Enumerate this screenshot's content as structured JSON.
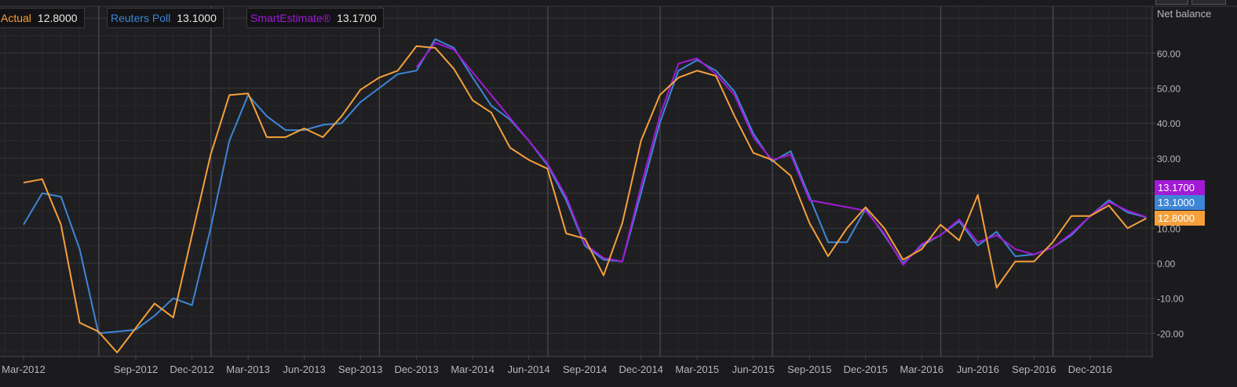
{
  "colors": {
    "background": "#1b1b1d",
    "plot_background": "#1f1f22",
    "grid": "#38383c",
    "axis_text": "#b8b8bc",
    "actual": "#f5a03a",
    "reuters": "#3d86d6",
    "smart": "#a21ad6"
  },
  "legend": {
    "actual": {
      "name": "Actual",
      "value": "12.8000"
    },
    "reuters": {
      "name": "Reuters Poll",
      "value": "13.1000"
    },
    "smart": {
      "name": "SmartEstimate®",
      "value": "13.1700"
    }
  },
  "badges": {
    "smart": "13.1700",
    "reuters": "13.1000",
    "actual": "12.8000"
  },
  "chart_data": {
    "type": "line",
    "ylabel": "Net balance",
    "ylim": [
      -25,
      73
    ],
    "y_ticks": [
      -20,
      -10,
      0,
      10,
      20,
      30,
      40,
      50,
      60
    ],
    "y_tick_labels": [
      "-20.00",
      "-10.00",
      "0.00",
      "10.00",
      "20.00",
      "30.00",
      "40.00",
      "50.00",
      "60.00"
    ],
    "x_labels": [
      {
        "t": 0,
        "label": "Mar-2012"
      },
      {
        "t": 6,
        "label": "Sep-2012"
      },
      {
        "t": 9,
        "label": "Dec-2012"
      },
      {
        "t": 12,
        "label": "Mar-2013"
      },
      {
        "t": 15,
        "label": "Jun-2013"
      },
      {
        "t": 18,
        "label": "Sep-2013"
      },
      {
        "t": 21,
        "label": "Dec-2013"
      },
      {
        "t": 24,
        "label": "Mar-2014"
      },
      {
        "t": 27,
        "label": "Jun-2014"
      },
      {
        "t": 30,
        "label": "Sep-2014"
      },
      {
        "t": 33,
        "label": "Dec-2014"
      },
      {
        "t": 36,
        "label": "Mar-2015"
      },
      {
        "t": 39,
        "label": "Jun-2015"
      },
      {
        "t": 42,
        "label": "Sep-2015"
      },
      {
        "t": 45,
        "label": "Dec-2015"
      },
      {
        "t": 48,
        "label": "Mar-2016"
      },
      {
        "t": 51,
        "label": "Jun-2016"
      },
      {
        "t": 54,
        "label": "Sep-2016"
      },
      {
        "t": 57,
        "label": "Dec-2016"
      }
    ],
    "x_range": [
      0,
      60
    ],
    "major_grid_t": [
      4,
      10,
      19,
      28,
      34,
      40,
      49,
      55
    ],
    "series": [
      {
        "name": "Reuters Poll",
        "key": "reuters",
        "points": [
          [
            0,
            11
          ],
          [
            1,
            20
          ],
          [
            2,
            19
          ],
          [
            3,
            4
          ],
          [
            4,
            -20
          ],
          [
            5,
            -19.5
          ],
          [
            6,
            -19
          ],
          [
            7,
            -15
          ],
          [
            8,
            -10
          ],
          [
            9,
            -12
          ],
          [
            10,
            10
          ],
          [
            11,
            35
          ],
          [
            12,
            48
          ],
          [
            13,
            42
          ],
          [
            14,
            38
          ],
          [
            15,
            38
          ],
          [
            16,
            39.5
          ],
          [
            17,
            40
          ],
          [
            18,
            46
          ],
          [
            19,
            50
          ],
          [
            20,
            54
          ],
          [
            21,
            55
          ],
          [
            22,
            64
          ],
          [
            23,
            61.5
          ],
          [
            24,
            53
          ],
          [
            25,
            45
          ],
          [
            26,
            41
          ],
          [
            27,
            35
          ],
          [
            28,
            28
          ],
          [
            29,
            18
          ],
          [
            30,
            5
          ],
          [
            31,
            1
          ],
          [
            32,
            0.5
          ],
          [
            33,
            20
          ],
          [
            34,
            40
          ],
          [
            35,
            55
          ],
          [
            36,
            58
          ],
          [
            37,
            55
          ],
          [
            38,
            49
          ],
          [
            39,
            37
          ],
          [
            40,
            29
          ],
          [
            41,
            32
          ],
          [
            42,
            19
          ],
          [
            43,
            6
          ],
          [
            44,
            6
          ],
          [
            45,
            15.5
          ],
          [
            46,
            8
          ],
          [
            47,
            0
          ],
          [
            48,
            5
          ],
          [
            49,
            8
          ],
          [
            50,
            12
          ],
          [
            51,
            5
          ],
          [
            52,
            9
          ],
          [
            53,
            2
          ],
          [
            54,
            2.5
          ],
          [
            55,
            4.5
          ],
          [
            56,
            8
          ],
          [
            57,
            13.5
          ],
          [
            58,
            18
          ],
          [
            59,
            14.5
          ],
          [
            60,
            13.1
          ]
        ]
      },
      {
        "name": "SmartEstimate®",
        "key": "smart",
        "points": [
          [
            21,
            56
          ],
          [
            22,
            63
          ],
          [
            23,
            61
          ],
          [
            28,
            28.5
          ],
          [
            29,
            19
          ],
          [
            30,
            5.5
          ],
          [
            31,
            1.5
          ],
          [
            32,
            0.5
          ],
          [
            33,
            22
          ],
          [
            34,
            42
          ],
          [
            35,
            57
          ],
          [
            36,
            58.5
          ],
          [
            37,
            54
          ],
          [
            38,
            48
          ],
          [
            39,
            36
          ],
          [
            40,
            29.5
          ],
          [
            41,
            31
          ],
          [
            42,
            18
          ],
          [
            45,
            15
          ],
          [
            46,
            8.5
          ],
          [
            47,
            -0.5
          ],
          [
            48,
            5.5
          ],
          [
            49,
            8
          ],
          [
            50,
            12.5
          ],
          [
            51,
            6
          ],
          [
            52,
            8
          ],
          [
            53,
            4
          ],
          [
            54,
            2.5
          ],
          [
            55,
            4.5
          ],
          [
            56,
            8.5
          ],
          [
            57,
            13.5
          ],
          [
            58,
            17.5
          ],
          [
            59,
            15
          ],
          [
            60,
            13.17
          ]
        ]
      },
      {
        "name": "Actual",
        "key": "actual",
        "points": [
          [
            0,
            23
          ],
          [
            1,
            24
          ],
          [
            2,
            11
          ],
          [
            3,
            -17
          ],
          [
            4,
            -19.5
          ],
          [
            5,
            -25.5
          ],
          [
            6,
            -18.5
          ],
          [
            7,
            -11.5
          ],
          [
            8,
            -15.5
          ],
          [
            9,
            8
          ],
          [
            10,
            31
          ],
          [
            11,
            48
          ],
          [
            12,
            48.5
          ],
          [
            13,
            36
          ],
          [
            14,
            36
          ],
          [
            15,
            38.5
          ],
          [
            16,
            36
          ],
          [
            17,
            42
          ],
          [
            18,
            49.5
          ],
          [
            19,
            53
          ],
          [
            20,
            55
          ],
          [
            21,
            62
          ],
          [
            22,
            61.5
          ],
          [
            23,
            55.5
          ],
          [
            24,
            46.5
          ],
          [
            25,
            43
          ],
          [
            26,
            33
          ],
          [
            27,
            29.5
          ],
          [
            28,
            27
          ],
          [
            29,
            8.5
          ],
          [
            30,
            7
          ],
          [
            31,
            -3.5
          ],
          [
            32,
            11.5
          ],
          [
            33,
            35
          ],
          [
            34,
            48
          ],
          [
            35,
            53
          ],
          [
            36,
            55
          ],
          [
            37,
            53.5
          ],
          [
            38,
            42
          ],
          [
            39,
            31.5
          ],
          [
            40,
            29.5
          ],
          [
            41,
            25
          ],
          [
            42,
            11.5
          ],
          [
            43,
            2
          ],
          [
            44,
            10
          ],
          [
            45,
            16
          ],
          [
            46,
            10
          ],
          [
            47,
            1
          ],
          [
            48,
            4
          ],
          [
            49,
            11
          ],
          [
            50,
            6.5
          ],
          [
            51,
            19.5
          ],
          [
            52,
            -7
          ],
          [
            53,
            0.5
          ],
          [
            54,
            0.5
          ],
          [
            55,
            6
          ],
          [
            56,
            13.5
          ],
          [
            57,
            13.5
          ],
          [
            58,
            16.5
          ],
          [
            59,
            10
          ],
          [
            60,
            12.8
          ]
        ]
      }
    ]
  }
}
